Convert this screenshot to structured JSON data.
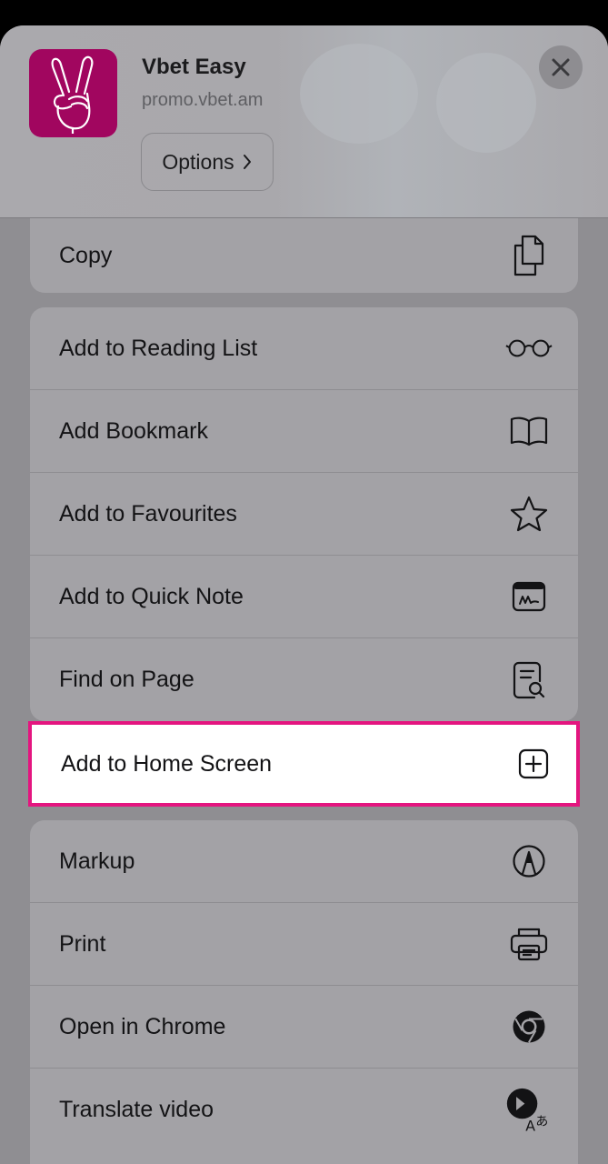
{
  "header": {
    "app_name": "Vbet Easy",
    "url": "promo.vbet.am",
    "options_label": "Options",
    "app_icon": "peace-hand-icon",
    "app_icon_color": "#a1065f"
  },
  "copy_group": {
    "label": "Copy",
    "icon": "copy-icon"
  },
  "actions_group": [
    {
      "label": "Add to Reading List",
      "icon": "glasses-icon"
    },
    {
      "label": "Add Bookmark",
      "icon": "book-icon"
    },
    {
      "label": "Add to Favourites",
      "icon": "star-icon"
    },
    {
      "label": "Add to Quick Note",
      "icon": "quick-note-icon"
    },
    {
      "label": "Find on Page",
      "icon": "find-on-page-icon"
    }
  ],
  "highlighted_action": {
    "label": "Add to Home Screen",
    "icon": "plus-square-icon",
    "highlight_color": "#e4157f"
  },
  "extensions_group": [
    {
      "label": "Markup",
      "icon": "markup-pen-icon"
    },
    {
      "label": "Print",
      "icon": "printer-icon"
    },
    {
      "label": "Open in Chrome",
      "icon": "chrome-icon"
    },
    {
      "label": "Translate video",
      "icon": "translate-video-icon"
    }
  ]
}
